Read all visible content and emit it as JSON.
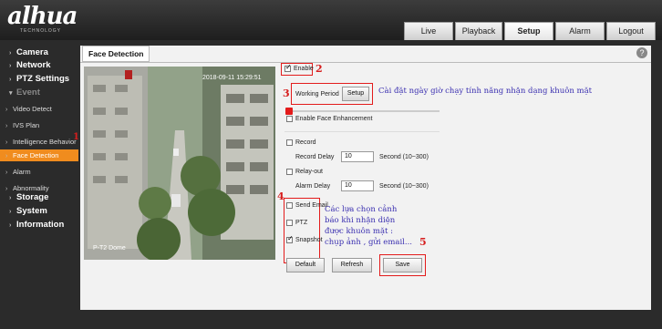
{
  "header": {
    "logo": "alhua",
    "logo_sub": "TECHNOLOGY",
    "tabs": [
      {
        "label": "Live"
      },
      {
        "label": "Playback"
      },
      {
        "label": "Setup"
      },
      {
        "label": "Alarm"
      },
      {
        "label": "Logout"
      }
    ],
    "active_tab": "Setup"
  },
  "sidebar": {
    "items": [
      {
        "label": "Camera"
      },
      {
        "label": "Network"
      },
      {
        "label": "PTZ Settings"
      },
      {
        "label": "Event"
      },
      {
        "label": "Video Detect"
      },
      {
        "label": "IVS Plan"
      },
      {
        "label": "Intelligence Behavior"
      },
      {
        "label": "Face Detection"
      },
      {
        "label": "Alarm"
      },
      {
        "label": "Abnormality"
      },
      {
        "label": "Storage"
      },
      {
        "label": "System"
      },
      {
        "label": "Information"
      }
    ],
    "annotation_1": "1"
  },
  "content": {
    "tab_title": "Face Detection",
    "help_icon": "?",
    "video": {
      "timestamp": "2018-09-11 15:29:51",
      "camera_name": "P-T2 Dome"
    },
    "form": {
      "enable_label": "Enable",
      "enable_checked": true,
      "working_period_label": "Working Period",
      "setup_button": "Setup",
      "enable_face_enhancement_label": "Enable Face Enhancement",
      "record_label": "Record",
      "record_delay_label": "Record Delay",
      "record_delay_value": "10",
      "record_delay_unit": "Second (10~300)",
      "relay_out_label": "Relay-out",
      "alarm_delay_label": "Alarm Delay",
      "alarm_delay_value": "10",
      "alarm_delay_unit": "Second (10~300)",
      "send_email_label": "Send Email",
      "ptz_label": "PTZ",
      "snapshot_label": "Snapshot",
      "snapshot_checked": true,
      "default_button": "Default",
      "refresh_button": "Refresh",
      "save_button": "Save"
    },
    "annotations": {
      "n2": "2",
      "n3": "3",
      "n4": "4",
      "n5": "5",
      "note_working_period": "Cài đặt ngày giờ chạy tính năng nhận dạng khuôn mặt",
      "note_actions_1": "Các lựa chọn cảnh",
      "note_actions_2": "báo khi nhận diện",
      "note_actions_3": "được khuôn mặt :",
      "note_actions_4": "chụp ảnh , gửi email..."
    }
  },
  "colors": {
    "accent_orange": "#f08c1e",
    "annotation_red": "#e31b1b",
    "annotation_blue": "#3a2fb0"
  }
}
